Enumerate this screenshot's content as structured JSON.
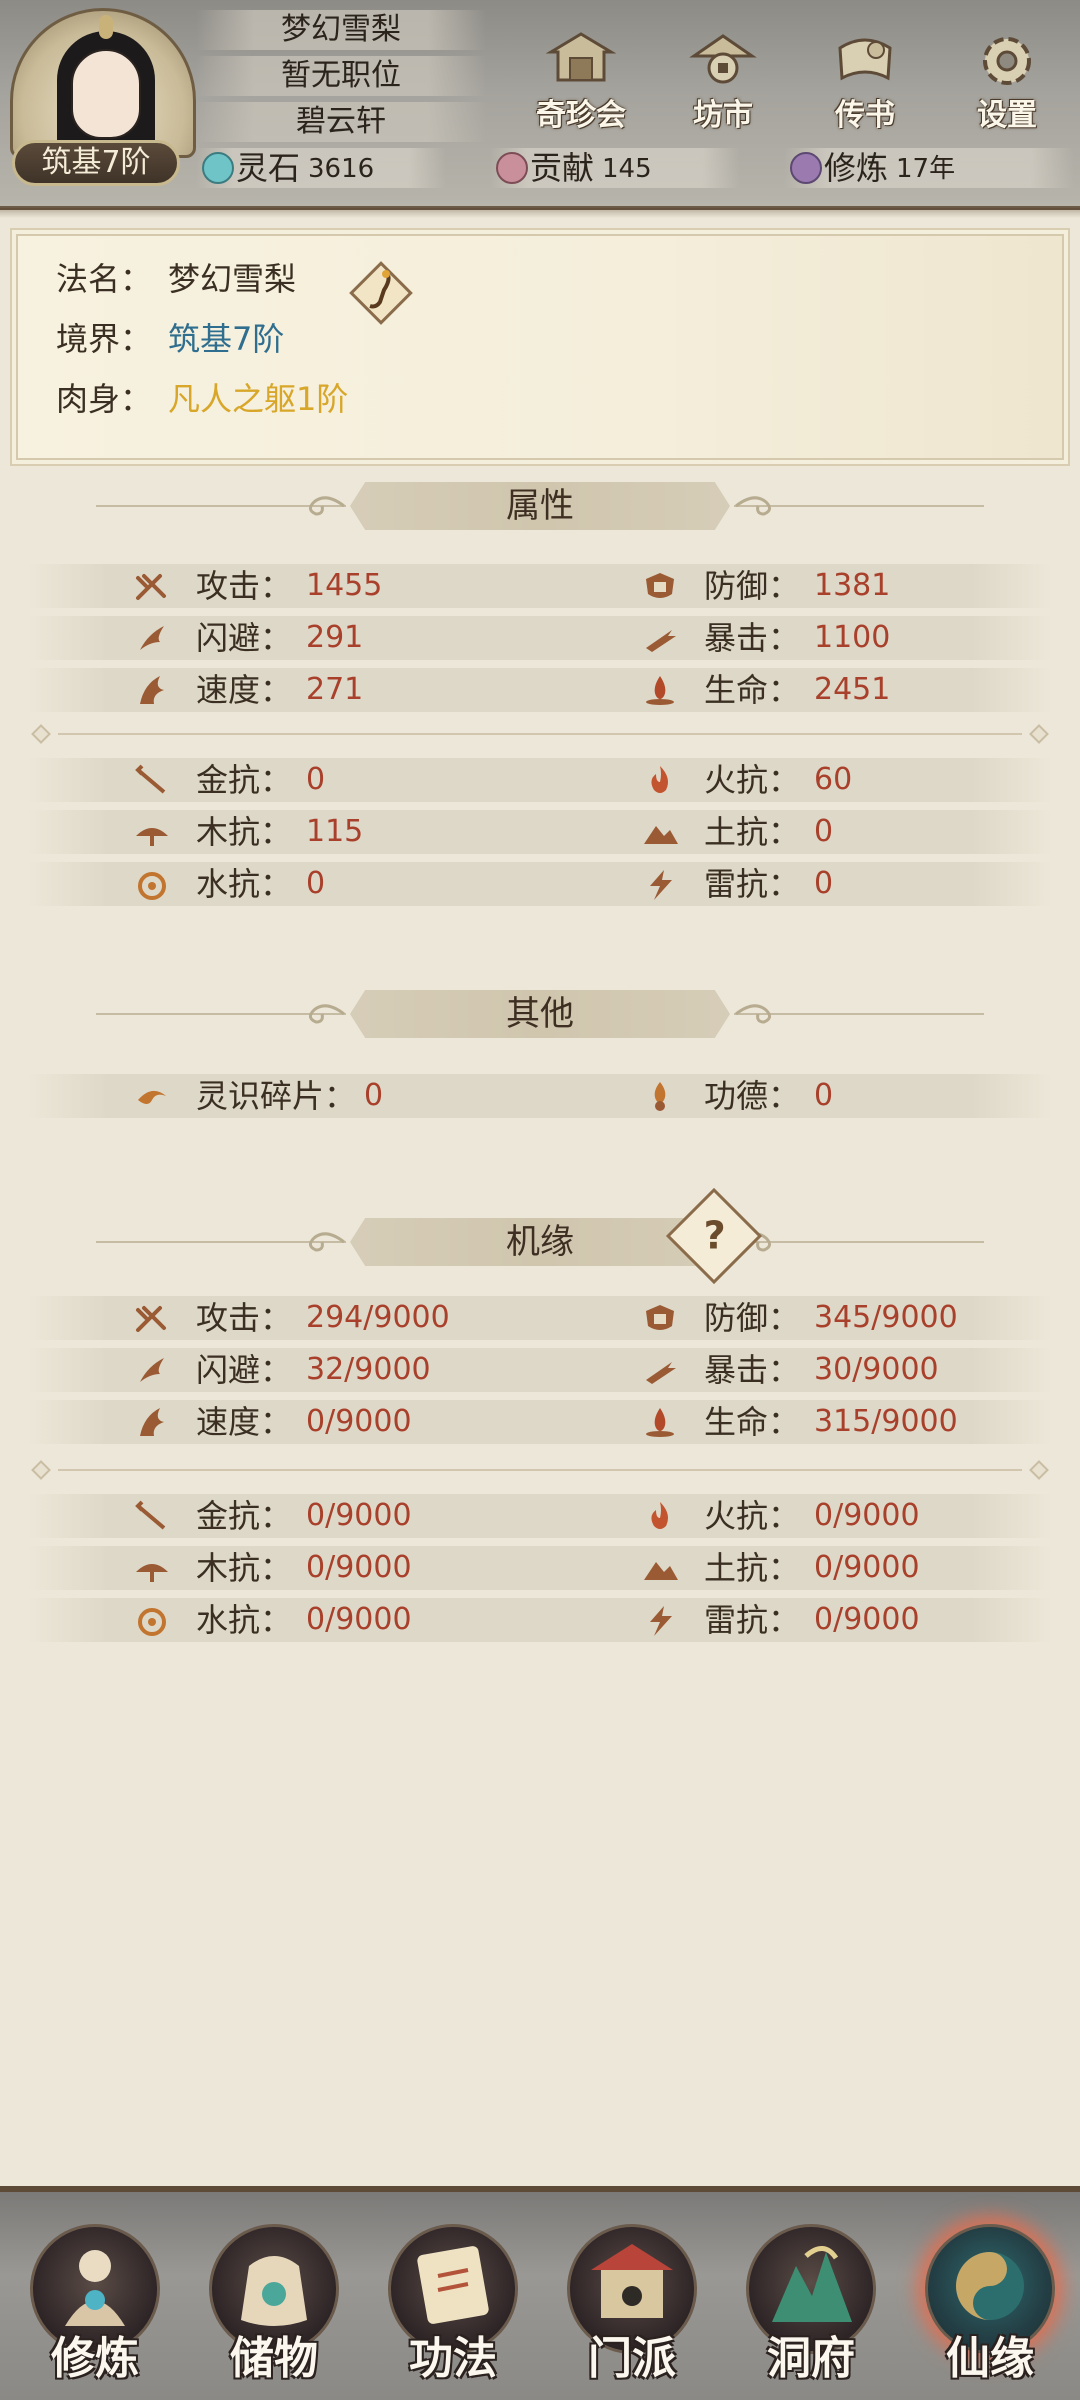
{
  "header": {
    "realm_badge": "筑基7阶",
    "name_plates": [
      "梦幻雪梨",
      "暂无职位",
      "碧云轩"
    ],
    "buttons": [
      {
        "label": "奇珍会",
        "icon": "treasure-pavilion-icon"
      },
      {
        "label": "坊市",
        "icon": "market-icon"
      },
      {
        "label": "传书",
        "icon": "scroll-letter-icon"
      },
      {
        "label": "设置",
        "icon": "gear-icon"
      }
    ],
    "resources": [
      {
        "name": "灵石",
        "value": "3616",
        "icon": "spirit-stone-icon",
        "color": "#6fc4c8"
      },
      {
        "name": "贡献",
        "value": "145",
        "icon": "contribution-icon",
        "color": "#c98f9a"
      },
      {
        "name": "修炼",
        "value": "17年",
        "icon": "cultivator-icon",
        "color": "#9b7ab0"
      }
    ]
  },
  "profile": {
    "dharma_name_label": "法名：",
    "dharma_name": "梦幻雪梨",
    "realm_label": "境界：",
    "realm": "筑基7阶",
    "body_label": "肉身：",
    "body": "凡人之躯1阶",
    "realm_color": "#2f6e8e",
    "body_color": "#d8a72a"
  },
  "sections": {
    "attributes": {
      "title": "属性",
      "rows": [
        [
          {
            "label": "攻击：",
            "value": "1455",
            "icon": "attack-icon"
          },
          {
            "label": "防御：",
            "value": "1381",
            "icon": "defense-icon"
          }
        ],
        [
          {
            "label": "闪避：",
            "value": "291",
            "icon": "dodge-icon"
          },
          {
            "label": "暴击：",
            "value": "1100",
            "icon": "crit-icon"
          }
        ],
        [
          {
            "label": "速度：",
            "value": "271",
            "icon": "speed-icon"
          },
          {
            "label": "生命：",
            "value": "2451",
            "icon": "life-icon"
          }
        ]
      ],
      "resist_rows": [
        [
          {
            "label": "金抗：",
            "value": "0",
            "icon": "metal-resist-icon"
          },
          {
            "label": "火抗：",
            "value": "60",
            "icon": "fire-resist-icon"
          }
        ],
        [
          {
            "label": "木抗：",
            "value": "115",
            "icon": "wood-resist-icon"
          },
          {
            "label": "土抗：",
            "value": "0",
            "icon": "earth-resist-icon"
          }
        ],
        [
          {
            "label": "水抗：",
            "value": "0",
            "icon": "water-resist-icon"
          },
          {
            "label": "雷抗：",
            "value": "0",
            "icon": "thunder-resist-icon"
          }
        ]
      ]
    },
    "other": {
      "title": "其他",
      "rows": [
        [
          {
            "label": "灵识碎片：",
            "value": "0",
            "icon": "soul-fragment-icon"
          },
          {
            "label": "功德：",
            "value": "0",
            "icon": "merit-icon"
          }
        ]
      ]
    },
    "fortune": {
      "title": "机缘",
      "help": "?",
      "rows": [
        [
          {
            "label": "攻击：",
            "value": "294/9000",
            "icon": "attack-icon"
          },
          {
            "label": "防御：",
            "value": "345/9000",
            "icon": "defense-icon"
          }
        ],
        [
          {
            "label": "闪避：",
            "value": "32/9000",
            "icon": "dodge-icon"
          },
          {
            "label": "暴击：",
            "value": "30/9000",
            "icon": "crit-icon"
          }
        ],
        [
          {
            "label": "速度：",
            "value": "0/9000",
            "icon": "speed-icon"
          },
          {
            "label": "生命：",
            "value": "315/9000",
            "icon": "life-icon"
          }
        ]
      ],
      "resist_rows": [
        [
          {
            "label": "金抗：",
            "value": "0/9000",
            "icon": "metal-resist-icon"
          },
          {
            "label": "火抗：",
            "value": "0/9000",
            "icon": "fire-resist-icon"
          }
        ],
        [
          {
            "label": "木抗：",
            "value": "0/9000",
            "icon": "wood-resist-icon"
          },
          {
            "label": "土抗：",
            "value": "0/9000",
            "icon": "earth-resist-icon"
          }
        ],
        [
          {
            "label": "水抗：",
            "value": "0/9000",
            "icon": "water-resist-icon"
          },
          {
            "label": "雷抗：",
            "value": "0/9000",
            "icon": "thunder-resist-icon"
          }
        ]
      ]
    }
  },
  "bottom_nav": [
    {
      "label": "修炼",
      "icon": "meditating-monk-icon",
      "active": false
    },
    {
      "label": "储物",
      "icon": "storage-bag-icon",
      "active": false
    },
    {
      "label": "功法",
      "icon": "technique-scroll-icon",
      "active": false
    },
    {
      "label": "门派",
      "icon": "sect-gate-icon",
      "active": false
    },
    {
      "label": "洞府",
      "icon": "cave-mountain-icon",
      "active": false
    },
    {
      "label": "仙缘",
      "icon": "taiji-icon",
      "active": true
    }
  ],
  "colors": {
    "value_red": "#a8402b",
    "icon_brown": "#9a5a34",
    "active_glow": "#e16e50"
  }
}
